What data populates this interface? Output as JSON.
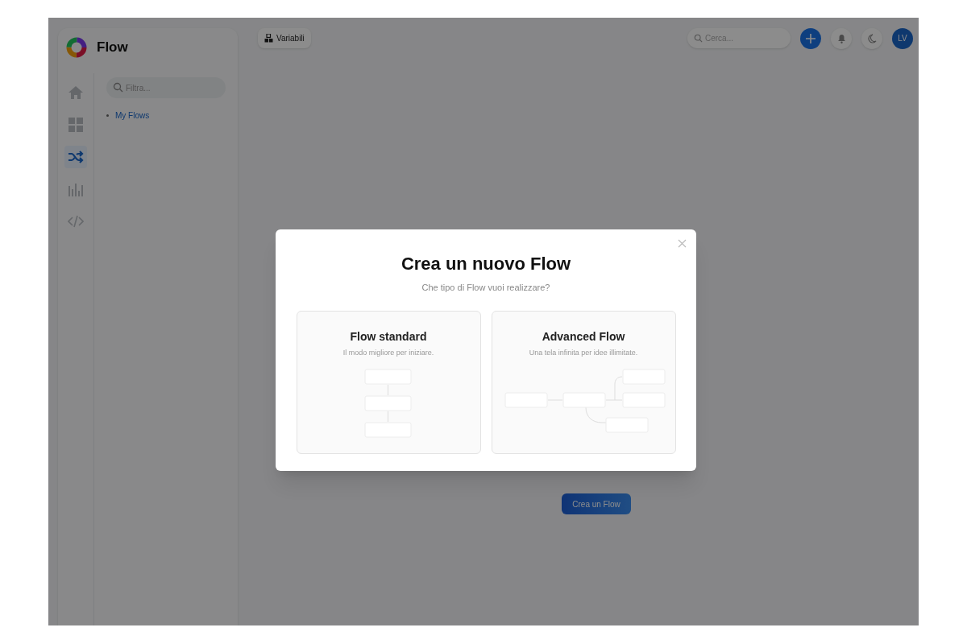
{
  "sidebar": {
    "logo_text": "Flow",
    "rail": [
      {
        "kind": "home",
        "selected": false
      },
      {
        "kind": "grid",
        "selected": false
      },
      {
        "kind": "flows",
        "selected": true
      },
      {
        "kind": "chart",
        "selected": false
      },
      {
        "kind": "code",
        "selected": false
      }
    ],
    "filter": {
      "placeholder": "Filtra..."
    },
    "tree": [
      {
        "label": "My Flows"
      }
    ]
  },
  "topbar": {
    "variables_button": "Variabili",
    "search": {
      "placeholder": "Cerca..."
    },
    "avatar": "LV"
  },
  "main": {
    "create_button": "Crea un Flow"
  },
  "modal": {
    "title": "Crea un nuovo Flow",
    "subtitle": "Che tipo di Flow vuoi realizzare?",
    "options": [
      {
        "kind": "standard",
        "title": "Flow standard",
        "description": "Il modo migliore per iniziare."
      },
      {
        "kind": "advanced",
        "title": "Advanced Flow",
        "description": "Una tela infinita per idee illimitate."
      }
    ]
  }
}
